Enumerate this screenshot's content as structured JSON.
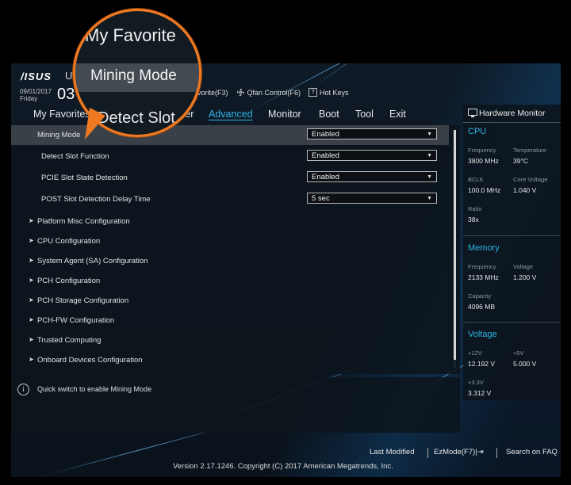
{
  "header": {
    "logo": "/ISUS",
    "title_partial": "U",
    "date": "09/01/2017",
    "day": "Friday",
    "time_partial": "03",
    "hotkeys": [
      {
        "label": "avorite(F3)",
        "icon": "star-icon"
      },
      {
        "label": "Qfan Control(F6)",
        "icon": "fan-icon"
      },
      {
        "label": "Hot Keys",
        "icon": "question-icon",
        "icon_glyph": "?"
      }
    ]
  },
  "tabs": [
    {
      "label": "My Favorites"
    },
    {
      "label": "ker"
    },
    {
      "label": "Advanced",
      "active": true
    },
    {
      "label": "Monitor"
    },
    {
      "label": "Boot"
    },
    {
      "label": "Tool"
    },
    {
      "label": "Exit"
    }
  ],
  "settings": [
    {
      "label": "Mining Mode",
      "value": "Enabled",
      "selected": true
    },
    {
      "label": "Detect Slot Function",
      "value": "Enabled"
    },
    {
      "label": "PCIE Slot State Detection",
      "value": "Enabled"
    },
    {
      "label": "POST Slot Detection Delay Time",
      "value": "5 sec"
    }
  ],
  "submenus": [
    "Platform Misc Configuration",
    "CPU Configuration",
    "System Agent (SA) Configuration",
    "PCH Configuration",
    "PCH Storage Configuration",
    "PCH-FW Configuration",
    "Trusted Computing",
    "Onboard Devices Configuration"
  ],
  "help": {
    "text": "Quick switch to enable  Mining Mode",
    "icon_glyph": "i"
  },
  "hardware_monitor": {
    "title": "Hardware Monitor",
    "cpu": {
      "heading": "CPU",
      "frequency_label": "Frequency",
      "frequency": "3800 MHz",
      "temperature_label": "Temperature",
      "temperature": "39°C",
      "bclk_label": "BCLK",
      "bclk": "100.0 MHz",
      "core_voltage_label": "Core Voltage",
      "core_voltage": "1.040 V",
      "ratio_label": "Ratio",
      "ratio": "38x"
    },
    "memory": {
      "heading": "Memory",
      "frequency_label": "Frequency",
      "frequency": "2133 MHz",
      "voltage_label": "Voltage",
      "voltage": "1.200 V",
      "capacity_label": "Capacity",
      "capacity": "4096 MB"
    },
    "voltage": {
      "heading": "Voltage",
      "v12_label": "+12V",
      "v12": "12.192 V",
      "v5_label": "+5V",
      "v5": "5.000 V",
      "v33_label": "+3.3V",
      "v33": "3.312 V"
    }
  },
  "footer": {
    "last_modified": "Last Modified",
    "ezmode": "EzMode(F7)|⇥",
    "search_faq": "Search on FAQ",
    "copyright": "Version 2.17.1246. Copyright (C) 2017 American Megatrends, Inc."
  },
  "magnifier": {
    "favorites_text": "My Favorite",
    "mining_mode_text": "Mining Mode",
    "detect_slot_text": "Detect Slot"
  },
  "colors": {
    "accent": "#2fb3e6",
    "highlight_orange": "#f07a22"
  }
}
